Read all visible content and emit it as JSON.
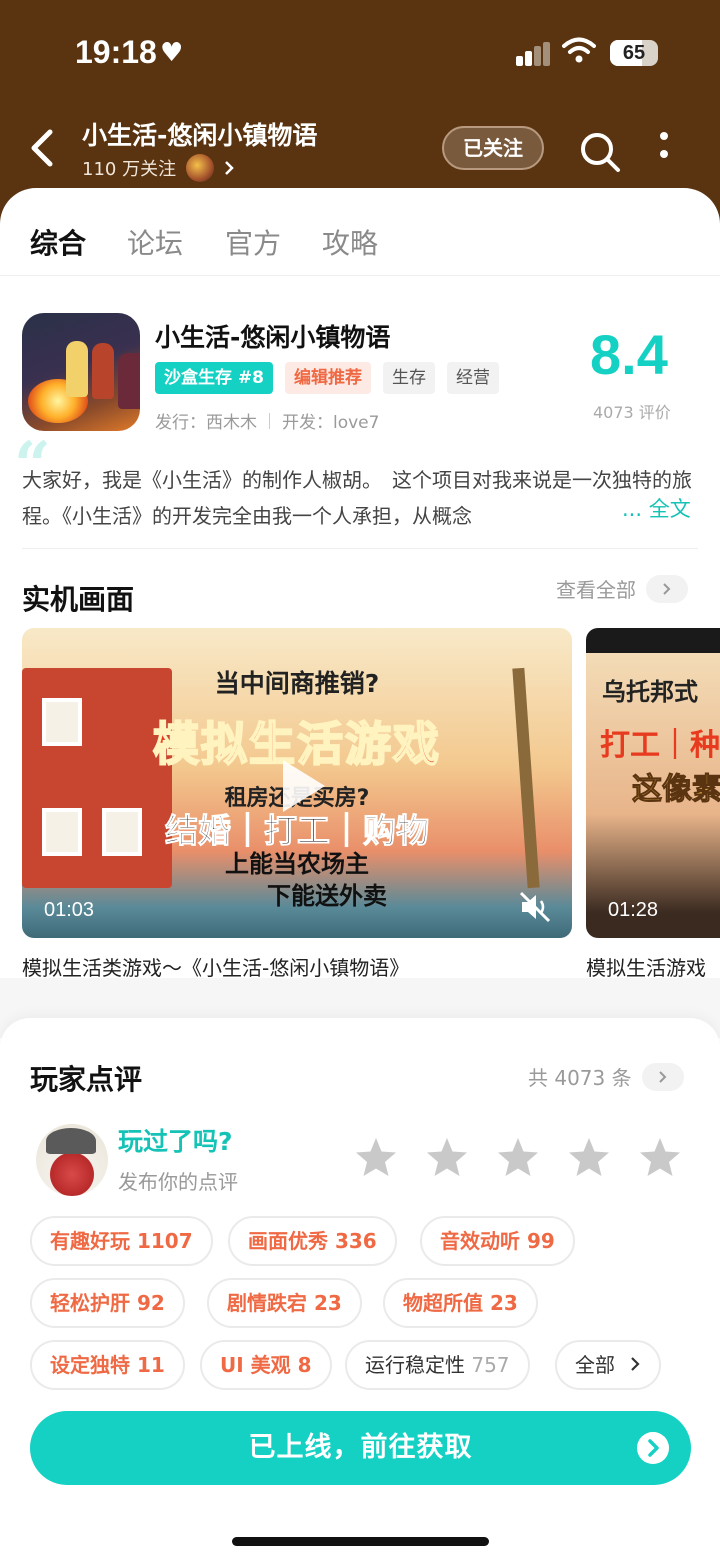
{
  "status_bar": {
    "time": "19:18",
    "battery": "65"
  },
  "header": {
    "title": "小生活-悠闲小镇物语",
    "followers": "110 万关注",
    "follow_button": "已关注"
  },
  "tabs": [
    "综合",
    "论坛",
    "官方",
    "攻略"
  ],
  "game": {
    "name": "小生活-悠闲小镇物语",
    "tags": [
      "沙盒生存 #8",
      "编辑推荐",
      "生存",
      "经营"
    ],
    "publisher": "发行：西木木",
    "developer": "开发：love7",
    "score": "8.4",
    "review_count": "4073 评价",
    "intro": "大家好，我是《小生活》的制作人椒胡。　这个项目对我来说是一次独特的旅程。《小生活》的开发完全由我一个人承担，从概念",
    "full_text": "... 全文"
  },
  "screenshots": {
    "title": "实机画面",
    "see_all": "查看全部",
    "videos": [
      {
        "caption": "模拟生活类游戏～《小生活-悠闲小镇物语》",
        "duration": "01:03",
        "lines": [
          "当中间商推销?",
          "模拟生活游戏",
          "租房还是买房?",
          "结婚｜打工｜购物",
          "上能当农场主",
          "下能送外卖"
        ]
      },
      {
        "caption": "模拟生活游戏",
        "duration": "01:28",
        "lines": [
          "乌托邦式",
          "打工｜种",
          "这像素"
        ]
      }
    ]
  },
  "reviews": {
    "title": "玩家点评",
    "total": "共 4073 条",
    "prompt": "玩过了吗?",
    "sub": "发布你的点评",
    "chips": [
      "有趣好玩 1107",
      "画面优秀 336",
      "音效动听 99",
      "轻松护肝 92",
      "剧情跌宕 23",
      "物超所值 23",
      "设定独特 11",
      "UI 美观 8"
    ],
    "neutral_chip": {
      "label": "运行稳定性",
      "count": "757"
    },
    "all_chip": "全部"
  },
  "cta": {
    "label": "已上线，前往获取"
  },
  "colors": {
    "accent": "#15d1c4",
    "header_bg": "#5a3410",
    "tag_orange": "#ef6a44"
  }
}
